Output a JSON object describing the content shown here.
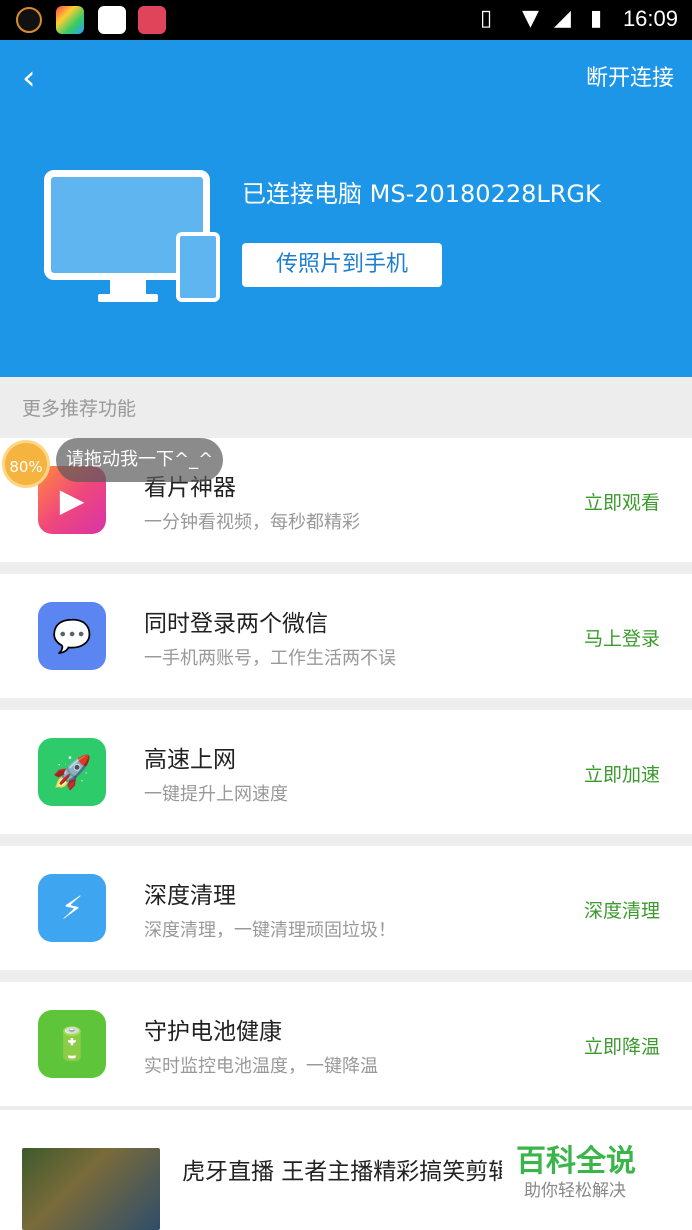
{
  "status_bar": {
    "time": "16:09"
  },
  "header": {
    "back_icon": "chevron-left-icon",
    "disconnect_label": "断开连接",
    "connected_text": "已连接电脑 MS-20180228LRGK",
    "transfer_button": "传照片到手机"
  },
  "section_title": "更多推荐功能",
  "floating": {
    "percent": "80%",
    "tip": "请拖动我一下^_^"
  },
  "cards": [
    {
      "title": "看片神器",
      "subtitle": "一分钟看视频，每秒都精彩",
      "action": "立即观看",
      "icon": "play-icon",
      "color": "#f0487b"
    },
    {
      "title": "同时登录两个微信",
      "subtitle": "一手机两账号，工作生活两不误",
      "action": "马上登录",
      "icon": "wechat-icon",
      "color": "#5b86f2"
    },
    {
      "title": "高速上网",
      "subtitle": "一键提升上网速度",
      "action": "立即加速",
      "icon": "rocket-icon",
      "color": "#2ecb6a"
    },
    {
      "title": "深度清理",
      "subtitle": "深度清理，一键清理顽固垃圾！",
      "action": "深度清理",
      "icon": "shield-icon",
      "color": "#3ea5f0"
    },
    {
      "title": "守护电池健康",
      "subtitle": "实时监控电池温度，一键降温",
      "action": "立即降温",
      "icon": "battery-icon",
      "color": "#5ec43a"
    }
  ],
  "news": {
    "title": "虎牙直播 王者主播精彩搞笑剪辑"
  },
  "watermark": {
    "title": "百科全说",
    "subtitle": "助你轻松解决"
  }
}
